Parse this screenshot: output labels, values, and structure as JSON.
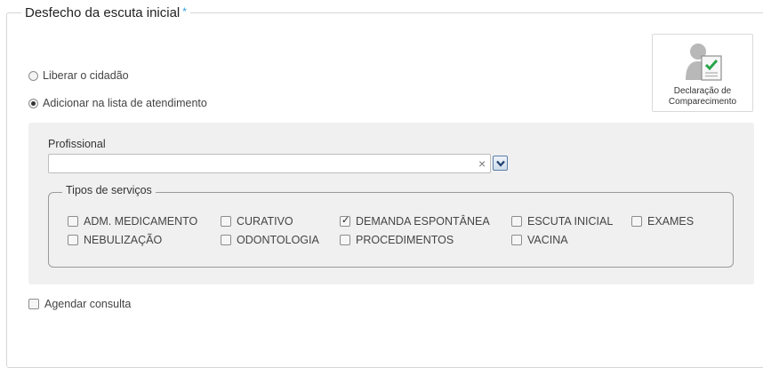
{
  "section": {
    "title": "Desfecho da escuta inicial",
    "required_mark": "*",
    "required_color": "#2f9fe0"
  },
  "options": {
    "liberar": {
      "label": "Liberar o cidadão",
      "selected": false
    },
    "adicionar": {
      "label": "Adicionar na lista de atendimento",
      "selected": true
    }
  },
  "declaracao": {
    "label_line1": "Declaração de",
    "label_line2": "Comparecimento",
    "icon": "person-document-check-icon"
  },
  "profissional": {
    "label": "Profissional",
    "value": "",
    "clear_glyph": "×"
  },
  "tipos": {
    "legend": "Tipos de serviços",
    "items": [
      {
        "label": "ADM. MEDICAMENTO",
        "checked": false
      },
      {
        "label": "CURATIVO",
        "checked": false
      },
      {
        "label": "DEMANDA ESPONTÂNEA",
        "checked": true
      },
      {
        "label": "ESCUTA INICIAL",
        "checked": false
      },
      {
        "label": "EXAMES",
        "checked": false
      },
      {
        "label": "NEBULIZAÇÃO",
        "checked": false
      },
      {
        "label": "ODONTOLOGIA",
        "checked": false
      },
      {
        "label": "PROCEDIMENTOS",
        "checked": false
      },
      {
        "label": "VACINA",
        "checked": false
      }
    ]
  },
  "agendar": {
    "label": "Agendar consulta",
    "checked": false
  }
}
